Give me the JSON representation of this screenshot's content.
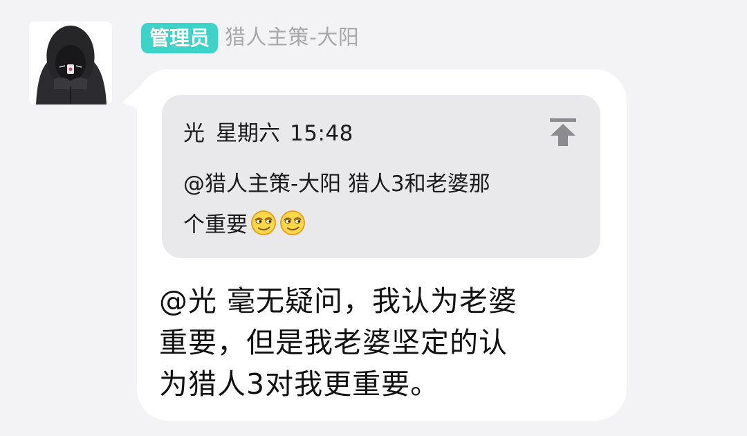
{
  "sender": {
    "role_badge": "管理员",
    "name": "猎人主策-大阳"
  },
  "quote": {
    "author": "光",
    "day": "星期六",
    "time": "15:48",
    "text_line1": "@猎人主策-大阳 猎人3和老婆那",
    "text_line2": "个重要",
    "emojis": [
      "smirk-emoji",
      "smirk-emoji"
    ],
    "pin_icon": "pin-to-top-icon"
  },
  "message": {
    "line1": "@光 毫无疑问，我认为老婆",
    "line2": "重要，但是我老婆坚定的认",
    "line3": "为猎人3对我更重要。"
  },
  "colors": {
    "background": "#f3f3f6",
    "badge": "#3ed3c8",
    "quote_card": "#e9e9ec",
    "bubble": "#ffffff"
  }
}
